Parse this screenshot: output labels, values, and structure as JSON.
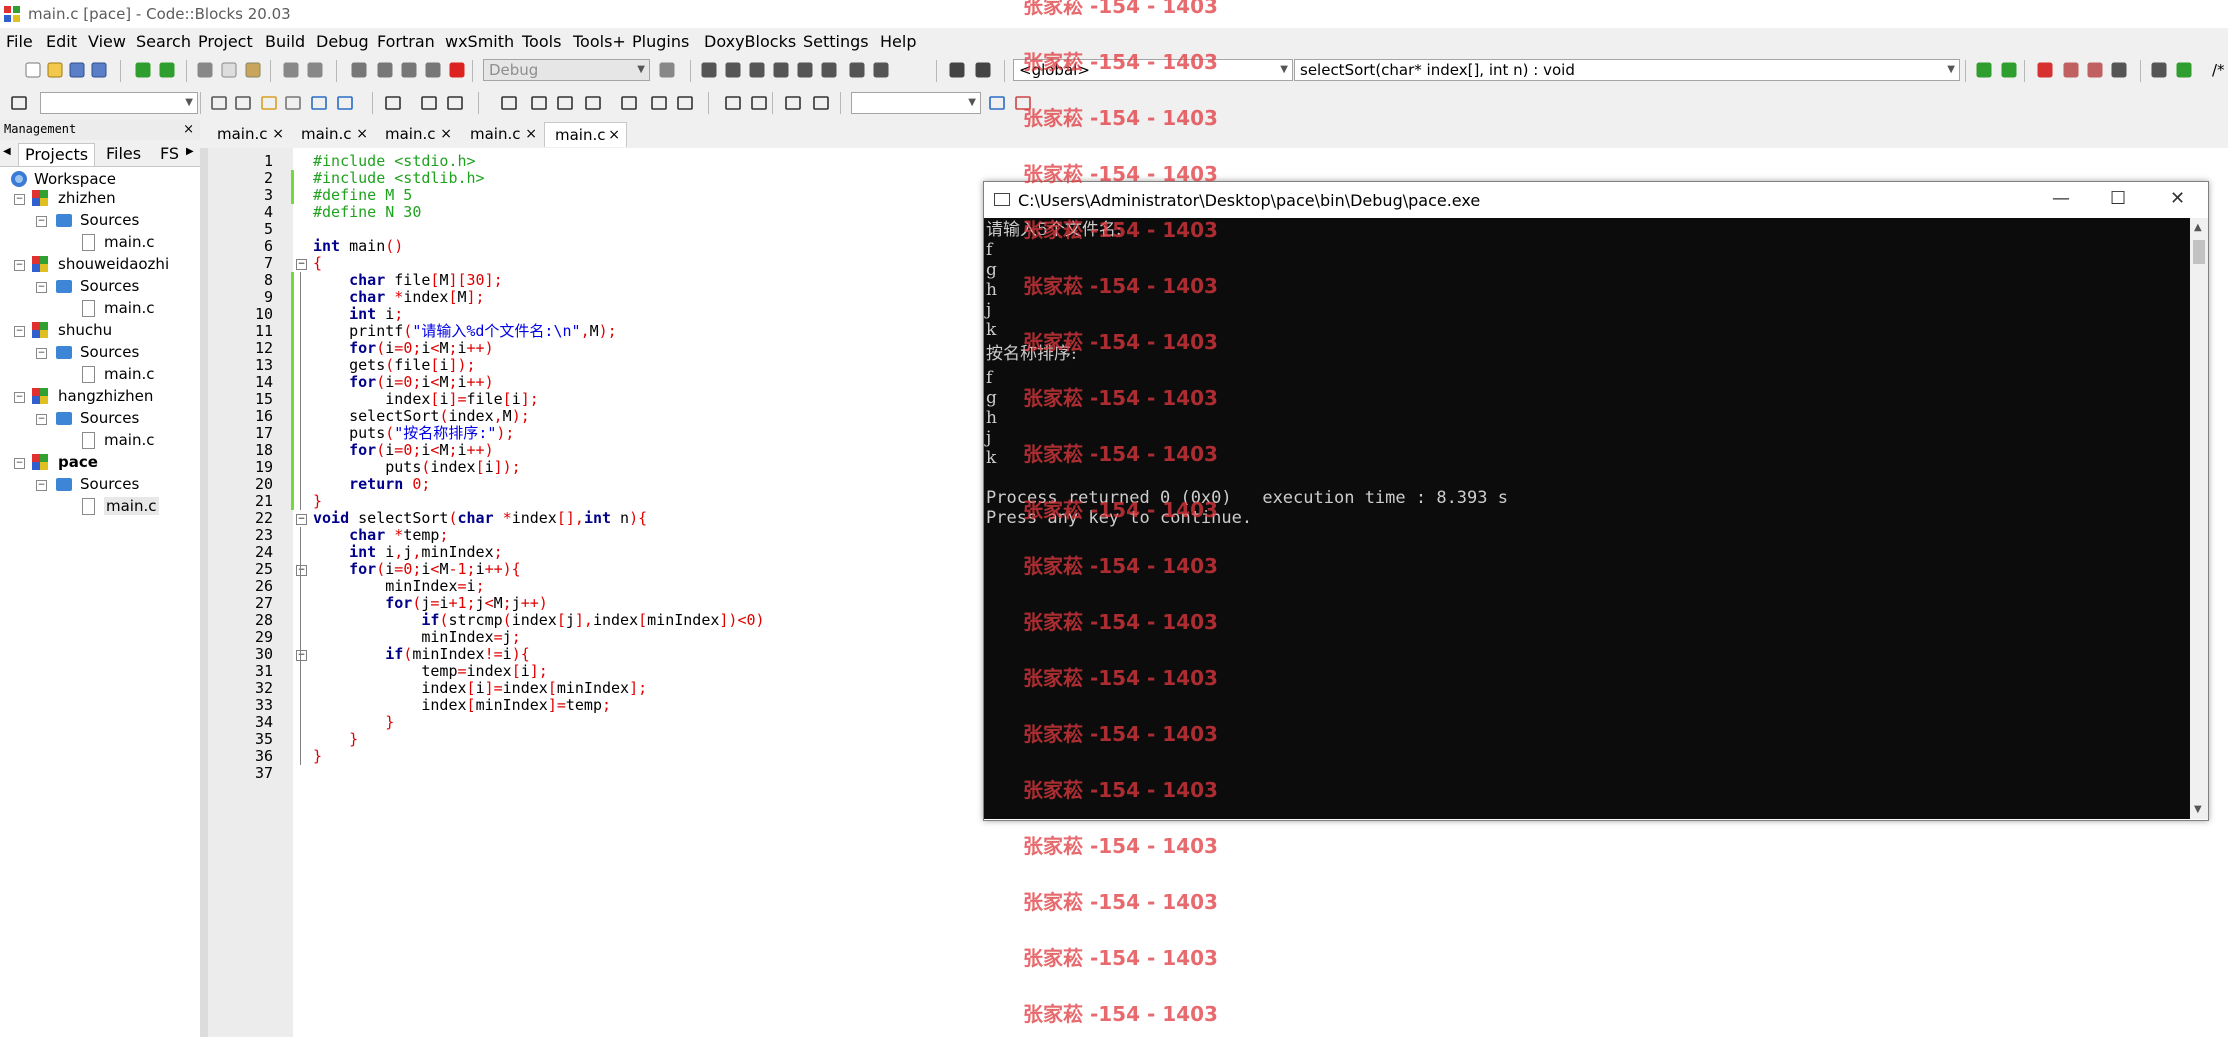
{
  "window": {
    "title": "main.c [pace] - Code::Blocks 20.03"
  },
  "menu": [
    "File",
    "Edit",
    "View",
    "Search",
    "Project",
    "Build",
    "Debug",
    "Fortran",
    "wxSmith",
    "Tools",
    "Tools+",
    "Plugins",
    "DoxyBlocks",
    "Settings",
    "Help"
  ],
  "toolbar": {
    "build_target": "Debug",
    "scope": "<global>",
    "function": "selectSort(char* index[], int n) : void",
    "partial_slash": "/*"
  },
  "management": {
    "title": "Management",
    "close": "×",
    "tabs": [
      "Projects",
      "Files",
      "FS"
    ],
    "workspace": "Workspace",
    "projects": [
      {
        "name": "zhizhen",
        "folder": "Sources",
        "file": "main.c"
      },
      {
        "name": "shouweidaozhi",
        "folder": "Sources",
        "file": "main.c"
      },
      {
        "name": "shuchu",
        "folder": "Sources",
        "file": "main.c"
      },
      {
        "name": "hangzhizhen",
        "folder": "Sources",
        "file": "main.c"
      },
      {
        "name": "pace",
        "folder": "Sources",
        "file": "main.c"
      }
    ]
  },
  "editor_tabs": [
    "main.c",
    "main.c",
    "main.c",
    "main.c",
    "main.c"
  ],
  "editor_tab_close": "×",
  "code_lines": [
    [
      [
        "pp",
        "#include <stdio.h>"
      ]
    ],
    [
      [
        "pp",
        "#include <stdlib.h>"
      ]
    ],
    [
      [
        "pp",
        "#define M 5"
      ]
    ],
    [
      [
        "pp",
        "#define N 30"
      ]
    ],
    [],
    [
      [
        "kw",
        "int"
      ],
      [
        "nr",
        " main"
      ],
      [
        "op",
        "()"
      ]
    ],
    [
      [
        "op",
        "{"
      ]
    ],
    [
      [
        "nr",
        "    "
      ],
      [
        "kw",
        "char"
      ],
      [
        "nr",
        " file"
      ],
      [
        "op",
        "["
      ],
      [
        "nr",
        "M"
      ],
      [
        "op",
        "]["
      ],
      [
        "nm",
        "30"
      ],
      [
        "op",
        "];"
      ]
    ],
    [
      [
        "nr",
        "    "
      ],
      [
        "kw",
        "char"
      ],
      [
        "nr",
        " "
      ],
      [
        "op",
        "*"
      ],
      [
        "nr",
        "index"
      ],
      [
        "op",
        "["
      ],
      [
        "nr",
        "M"
      ],
      [
        "op",
        "];"
      ]
    ],
    [
      [
        "nr",
        "    "
      ],
      [
        "kw",
        "int"
      ],
      [
        "nr",
        " i"
      ],
      [
        "op",
        ";"
      ]
    ],
    [
      [
        "nr",
        "    printf"
      ],
      [
        "op",
        "("
      ],
      [
        "st",
        "\"请输入%d个文件名:\\n\""
      ],
      [
        "op",
        ","
      ],
      [
        "nr",
        "M"
      ],
      [
        "op",
        ");"
      ]
    ],
    [
      [
        "nr",
        "    "
      ],
      [
        "kw",
        "for"
      ],
      [
        "op",
        "("
      ],
      [
        "nr",
        "i"
      ],
      [
        "op",
        "="
      ],
      [
        "nm",
        "0"
      ],
      [
        "op",
        ";"
      ],
      [
        "nr",
        "i"
      ],
      [
        "op",
        "<"
      ],
      [
        "nr",
        "M"
      ],
      [
        "op",
        ";"
      ],
      [
        "nr",
        "i"
      ],
      [
        "op",
        "++)"
      ]
    ],
    [
      [
        "nr",
        "    gets"
      ],
      [
        "op",
        "("
      ],
      [
        "nr",
        "file"
      ],
      [
        "op",
        "["
      ],
      [
        "nr",
        "i"
      ],
      [
        "op",
        "]);"
      ]
    ],
    [
      [
        "nr",
        "    "
      ],
      [
        "kw",
        "for"
      ],
      [
        "op",
        "("
      ],
      [
        "nr",
        "i"
      ],
      [
        "op",
        "="
      ],
      [
        "nm",
        "0"
      ],
      [
        "op",
        ";"
      ],
      [
        "nr",
        "i"
      ],
      [
        "op",
        "<"
      ],
      [
        "nr",
        "M"
      ],
      [
        "op",
        ";"
      ],
      [
        "nr",
        "i"
      ],
      [
        "op",
        "++)"
      ]
    ],
    [
      [
        "nr",
        "        index"
      ],
      [
        "op",
        "["
      ],
      [
        "nr",
        "i"
      ],
      [
        "op",
        "]="
      ],
      [
        "nr",
        "file"
      ],
      [
        "op",
        "["
      ],
      [
        "nr",
        "i"
      ],
      [
        "op",
        "];"
      ]
    ],
    [
      [
        "nr",
        "    selectSort"
      ],
      [
        "op",
        "("
      ],
      [
        "nr",
        "index"
      ],
      [
        "op",
        ","
      ],
      [
        "nr",
        "M"
      ],
      [
        "op",
        ");"
      ]
    ],
    [
      [
        "nr",
        "    puts"
      ],
      [
        "op",
        "("
      ],
      [
        "st",
        "\"按名称排序:\""
      ],
      [
        "op",
        ");"
      ]
    ],
    [
      [
        "nr",
        "    "
      ],
      [
        "kw",
        "for"
      ],
      [
        "op",
        "("
      ],
      [
        "nr",
        "i"
      ],
      [
        "op",
        "="
      ],
      [
        "nm",
        "0"
      ],
      [
        "op",
        ";"
      ],
      [
        "nr",
        "i"
      ],
      [
        "op",
        "<"
      ],
      [
        "nr",
        "M"
      ],
      [
        "op",
        ";"
      ],
      [
        "nr",
        "i"
      ],
      [
        "op",
        "++)"
      ]
    ],
    [
      [
        "nr",
        "        puts"
      ],
      [
        "op",
        "("
      ],
      [
        "nr",
        "index"
      ],
      [
        "op",
        "["
      ],
      [
        "nr",
        "i"
      ],
      [
        "op",
        "]);"
      ]
    ],
    [
      [
        "nr",
        "    "
      ],
      [
        "kw",
        "return"
      ],
      [
        "nr",
        " "
      ],
      [
        "nm",
        "0"
      ],
      [
        "op",
        ";"
      ]
    ],
    [
      [
        "op",
        "}"
      ]
    ],
    [
      [
        "kw",
        "void"
      ],
      [
        "nr",
        " selectSort"
      ],
      [
        "op",
        "("
      ],
      [
        "kw",
        "char"
      ],
      [
        "nr",
        " "
      ],
      [
        "op",
        "*"
      ],
      [
        "nr",
        "index"
      ],
      [
        "op",
        "[],"
      ],
      [
        "kw",
        "int"
      ],
      [
        "nr",
        " n"
      ],
      [
        "op",
        "){"
      ]
    ],
    [
      [
        "nr",
        "    "
      ],
      [
        "kw",
        "char"
      ],
      [
        "nr",
        " "
      ],
      [
        "op",
        "*"
      ],
      [
        "nr",
        "temp"
      ],
      [
        "op",
        ";"
      ]
    ],
    [
      [
        "nr",
        "    "
      ],
      [
        "kw",
        "int"
      ],
      [
        "nr",
        " i"
      ],
      [
        "op",
        ","
      ],
      [
        "nr",
        "j"
      ],
      [
        "op",
        ","
      ],
      [
        "nr",
        "minIndex"
      ],
      [
        "op",
        ";"
      ]
    ],
    [
      [
        "nr",
        "    "
      ],
      [
        "kw",
        "for"
      ],
      [
        "op",
        "("
      ],
      [
        "nr",
        "i"
      ],
      [
        "op",
        "="
      ],
      [
        "nm",
        "0"
      ],
      [
        "op",
        ";"
      ],
      [
        "nr",
        "i"
      ],
      [
        "op",
        "<"
      ],
      [
        "nr",
        "M"
      ],
      [
        "op",
        "-"
      ],
      [
        "nm",
        "1"
      ],
      [
        "op",
        ";"
      ],
      [
        "nr",
        "i"
      ],
      [
        "op",
        "++){"
      ]
    ],
    [
      [
        "nr",
        "        minIndex"
      ],
      [
        "op",
        "="
      ],
      [
        "nr",
        "i"
      ],
      [
        "op",
        ";"
      ]
    ],
    [
      [
        "nr",
        "        "
      ],
      [
        "kw",
        "for"
      ],
      [
        "op",
        "("
      ],
      [
        "nr",
        "j"
      ],
      [
        "op",
        "="
      ],
      [
        "nr",
        "i"
      ],
      [
        "op",
        "+"
      ],
      [
        "nm",
        "1"
      ],
      [
        "op",
        ";"
      ],
      [
        "nr",
        "j"
      ],
      [
        "op",
        "<"
      ],
      [
        "nr",
        "M"
      ],
      [
        "op",
        ";"
      ],
      [
        "nr",
        "j"
      ],
      [
        "op",
        "++)"
      ]
    ],
    [
      [
        "nr",
        "            "
      ],
      [
        "kw",
        "if"
      ],
      [
        "op",
        "("
      ],
      [
        "nr",
        "strcmp"
      ],
      [
        "op",
        "("
      ],
      [
        "nr",
        "index"
      ],
      [
        "op",
        "["
      ],
      [
        "nr",
        "j"
      ],
      [
        "op",
        "],"
      ],
      [
        "nr",
        "index"
      ],
      [
        "op",
        "["
      ],
      [
        "nr",
        "minIndex"
      ],
      [
        "op",
        "])<"
      ],
      [
        "nm",
        "0"
      ],
      [
        "op",
        ")"
      ]
    ],
    [
      [
        "nr",
        "            minIndex"
      ],
      [
        "op",
        "="
      ],
      [
        "nr",
        "j"
      ],
      [
        "op",
        ";"
      ]
    ],
    [
      [
        "nr",
        "        "
      ],
      [
        "kw",
        "if"
      ],
      [
        "op",
        "("
      ],
      [
        "nr",
        "minIndex"
      ],
      [
        "op",
        "!="
      ],
      [
        "nr",
        "i"
      ],
      [
        "op",
        "){"
      ]
    ],
    [
      [
        "nr",
        "            temp"
      ],
      [
        "op",
        "="
      ],
      [
        "nr",
        "index"
      ],
      [
        "op",
        "["
      ],
      [
        "nr",
        "i"
      ],
      [
        "op",
        "];"
      ]
    ],
    [
      [
        "nr",
        "            index"
      ],
      [
        "op",
        "["
      ],
      [
        "nr",
        "i"
      ],
      [
        "op",
        "]="
      ],
      [
        "nr",
        "index"
      ],
      [
        "op",
        "["
      ],
      [
        "nr",
        "minIndex"
      ],
      [
        "op",
        "];"
      ]
    ],
    [
      [
        "nr",
        "            index"
      ],
      [
        "op",
        "["
      ],
      [
        "nr",
        "minIndex"
      ],
      [
        "op",
        "]="
      ],
      [
        "nr",
        "temp"
      ],
      [
        "op",
        ";"
      ]
    ],
    [
      [
        "nr",
        "        "
      ],
      [
        "op",
        "}"
      ]
    ],
    [
      [
        "nr",
        "    "
      ],
      [
        "op",
        "}"
      ]
    ],
    [
      [
        "op",
        "}"
      ]
    ],
    []
  ],
  "console": {
    "title": "C:\\Users\\Administrator\\Desktop\\pace\\bin\\Debug\\pace.exe",
    "minimize": "—",
    "maximize": "☐",
    "close": "✕",
    "prompt": "请输入5个文件名:",
    "inputs": [
      "f",
      "g",
      "h",
      "j",
      "k"
    ],
    "sorted_header": "按名称排序:",
    "outputs": [
      "f",
      "g",
      "h",
      "j",
      "k"
    ],
    "return_line": "Process returned 0 (0x0)   execution time : 8.393 s",
    "press_key": "Press any key to continue."
  },
  "watermark": "张家菘 -154 - 1403",
  "colors": {
    "preprocessor": "#1fa31f",
    "keyword": "#00008b",
    "operator": "#e00000",
    "string": "#0000e6",
    "console_bg": "#0c0c0c",
    "watermark": "#e0393e"
  }
}
